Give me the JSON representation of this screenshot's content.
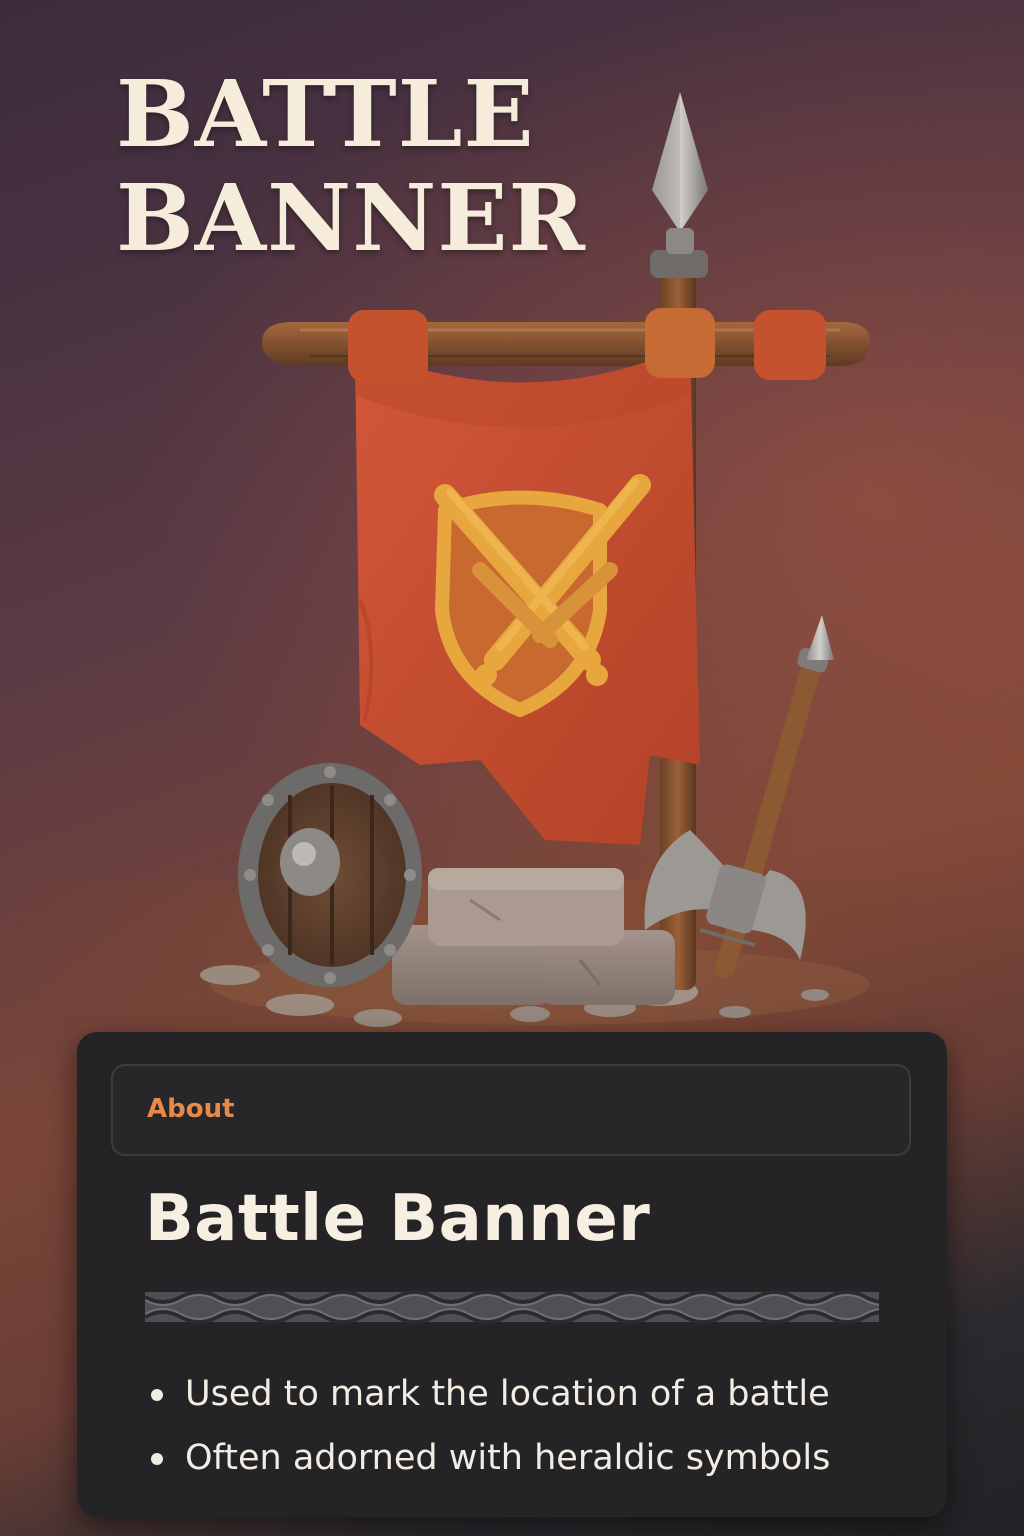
{
  "hero": {
    "title_line1": "BATTLE",
    "title_line2": "BANNER",
    "illustration_icon": "battle-banner-icon"
  },
  "info_card": {
    "tab_label": "About",
    "title": "Battle Banner",
    "facts": [
      "Used to mark the location of a battle",
      "Often adorned with heraldic symbols"
    ]
  },
  "colors": {
    "accent": "#e8894a",
    "banner": "#c44a2c",
    "emblem": "#e8a63e",
    "card_bg": "#242427",
    "title_text": "#f6ecdc"
  }
}
